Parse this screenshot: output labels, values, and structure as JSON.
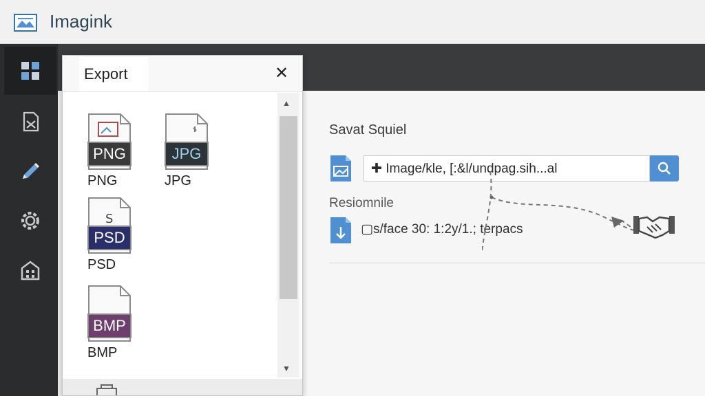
{
  "app": {
    "title": "Imagink"
  },
  "rail": {
    "items": [
      {
        "icon": "layout-icon"
      },
      {
        "icon": "file-export-icon"
      },
      {
        "icon": "pencil-icon"
      },
      {
        "icon": "gear-icon"
      },
      {
        "icon": "building-icon"
      }
    ]
  },
  "dialog": {
    "tab_label": "Export",
    "close_symbol": "✕",
    "formats": [
      {
        "badge": "PNG",
        "label": "PNG",
        "color": "#3a3a3a"
      },
      {
        "badge": "JPG",
        "label": "JPG",
        "color": "#2c3438"
      },
      {
        "badge": "PSD",
        "label": "PSD",
        "color": "#2a2f6b"
      },
      {
        "badge": "BMP",
        "label": "BMP",
        "color": "#6e3f6e"
      }
    ],
    "scroll_up": "▲",
    "scroll_down": "▼"
  },
  "main": {
    "section_title": "Savat Squiel",
    "path_value": "✚ Image/kle, [:&l/undpag.sih...al",
    "section_label": "Resiomnile",
    "info_text": "▢s/face 30: 1:2y/1.; terpacs"
  },
  "colors": {
    "accent": "#4f8fd2",
    "rail": "#2b2c2e",
    "topband": "#3a3b3d"
  }
}
